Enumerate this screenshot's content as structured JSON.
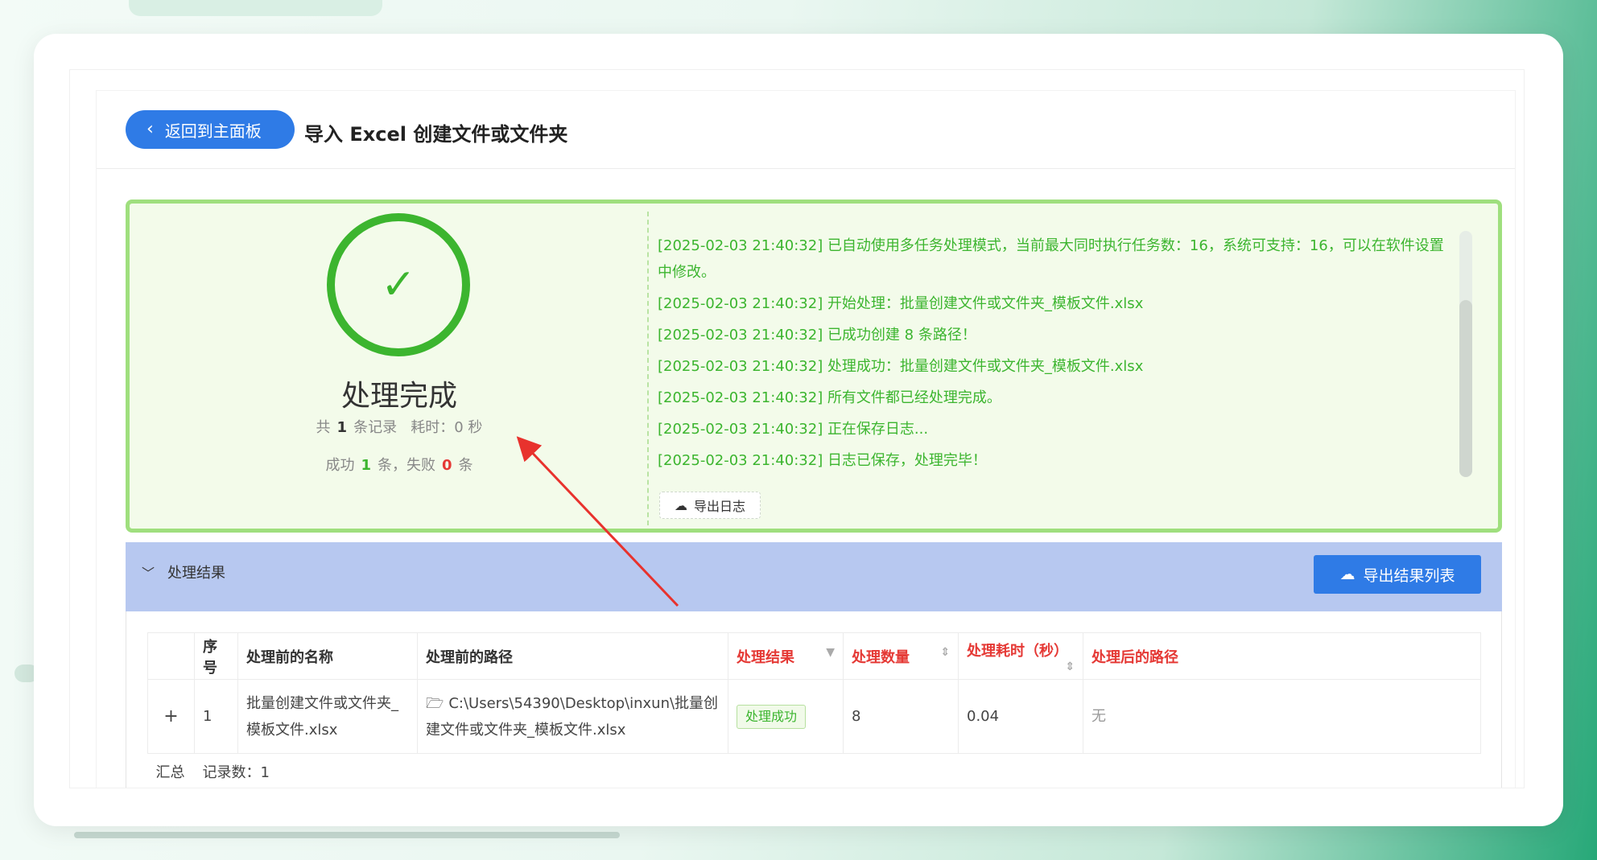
{
  "header": {
    "back_label": "返回到主面板",
    "title": "导入 Excel 创建文件或文件夹"
  },
  "status": {
    "title": "处理完成",
    "total_prefix": "共",
    "total_count": "1",
    "total_suffix": "条记录",
    "elapsed_label": "耗时：0 秒",
    "success_prefix": "成功",
    "success_count": "1",
    "success_suffix": "条，失败",
    "fail_count": "0",
    "fail_suffix": "条",
    "success_color": "#3cb52f",
    "fail_color": "#e53935"
  },
  "log": {
    "lines": [
      "[2025-02-03 21:40:32] 已自动使用多任务处理模式，当前最大同时执行任务数：16，系统可支持：16，可以在软件设置中修改。",
      "[2025-02-03 21:40:32] 开始处理：批量创建文件或文件夹_模板文件.xlsx",
      "[2025-02-03 21:40:32] 已成功创建 8 条路径！",
      "[2025-02-03 21:40:32] 处理成功：批量创建文件或文件夹_模板文件.xlsx",
      "[2025-02-03 21:40:32] 所有文件都已经处理完成。",
      "[2025-02-03 21:40:32] 正在保存日志...",
      "[2025-02-03 21:40:32] 日志已保存，处理完毕！"
    ],
    "export_label": "导出日志"
  },
  "results": {
    "section_label": "处理结果",
    "export_label": "导出结果列表",
    "columns": [
      "",
      "序号",
      "处理前的名称",
      "处理前的路径",
      "处理结果",
      "处理数量",
      "处理耗时（秒）",
      "处理后的路径"
    ],
    "rows": [
      {
        "expand": "+",
        "index": "1",
        "name": "批量创建文件或文件夹_模板文件.xlsx",
        "path": "C:\\Users\\54390\\Desktop\\inxun\\批量创建文件或文件夹_模板文件.xlsx",
        "result": "处理成功",
        "count": "8",
        "time": "0.04",
        "after_path": "无"
      }
    ],
    "summary_label": "汇总",
    "summary_value": "记录数：1"
  },
  "icons": {
    "back": "chevron-left-icon",
    "check": "check-icon",
    "cloud_upload": "cloud-upload-icon",
    "collapse": "chevron-down-icon",
    "folder": "folder-icon",
    "sort": "sort-icon",
    "filter": "filter-icon"
  },
  "colors": {
    "primary": "#2f7be6",
    "success_border": "#9fdf7e",
    "success_bg": "#f3fbea",
    "section_bar": "#b7c8f0",
    "annotation_arrow": "#e8322d"
  }
}
